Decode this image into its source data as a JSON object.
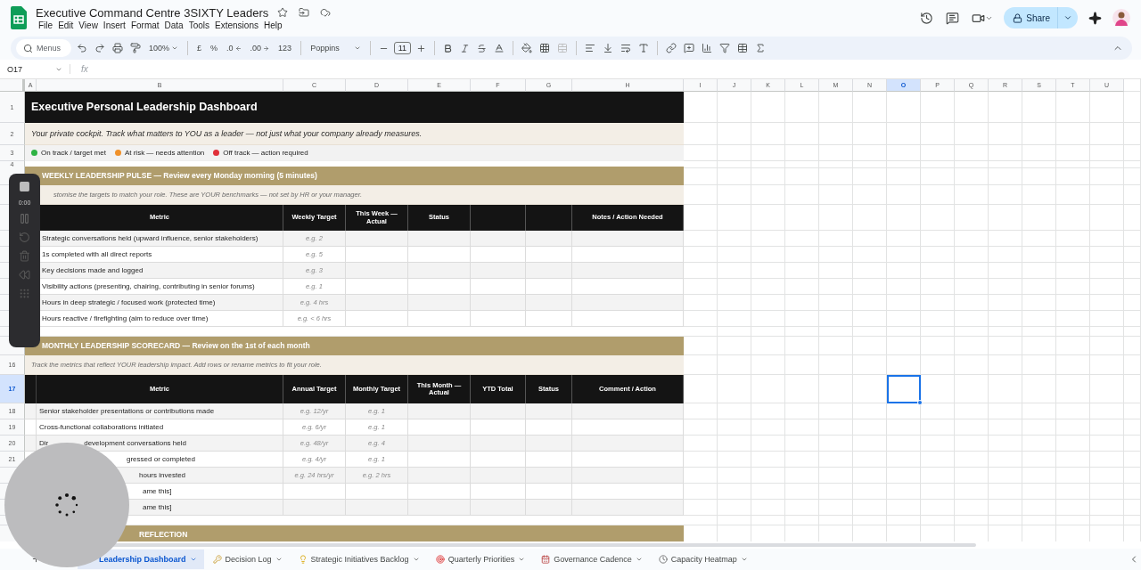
{
  "window": {
    "title": "Executive Command Centre 3SIXTY Leaders"
  },
  "menu": [
    "File",
    "Edit",
    "View",
    "Insert",
    "Format",
    "Data",
    "Tools",
    "Extensions",
    "Help"
  ],
  "share": {
    "label": "Share"
  },
  "toolbar": {
    "search_placeholder": "Menus",
    "zoom": "100%",
    "currency": "£",
    "percent": "%",
    "decrease_decimals": ".0",
    "increase_decimals": ".00",
    "number_format": "123",
    "font": "Poppins",
    "font_size": "11"
  },
  "formula_bar": {
    "cell_ref": "O17",
    "fx": "fx"
  },
  "columns": [
    {
      "label": "A",
      "selected": false
    },
    {
      "label": "B",
      "selected": false
    },
    {
      "label": "C",
      "selected": false
    },
    {
      "label": "D",
      "selected": false
    },
    {
      "label": "E",
      "selected": false
    },
    {
      "label": "F",
      "selected": false
    },
    {
      "label": "G",
      "selected": false
    },
    {
      "label": "H",
      "selected": false
    },
    {
      "label": "I",
      "selected": false
    },
    {
      "label": "J",
      "selected": false
    },
    {
      "label": "K",
      "selected": false
    },
    {
      "label": "L",
      "selected": false
    },
    {
      "label": "M",
      "selected": false
    },
    {
      "label": "N",
      "selected": false
    },
    {
      "label": "O",
      "selected": true
    },
    {
      "label": "P",
      "selected": false
    },
    {
      "label": "Q",
      "selected": false
    },
    {
      "label": "R",
      "selected": false
    },
    {
      "label": "S",
      "selected": false
    },
    {
      "label": "T",
      "selected": false
    },
    {
      "label": "U",
      "selected": false
    }
  ],
  "rows": [
    {
      "kind": "title",
      "number": "1",
      "selected": false,
      "text": "Executive Personal Leadership Dashboard"
    },
    {
      "kind": "subtitle",
      "number": "2",
      "selected": false,
      "text": "Your private cockpit. Track what matters to YOU as a leader — not just what your company already measures."
    },
    {
      "kind": "legend",
      "number": "3",
      "selected": false,
      "items": [
        {
          "label": "On track / target met",
          "color": "#2fb344"
        },
        {
          "label": "At risk — needs attention",
          "color": "#f0912a"
        },
        {
          "label": "Off track — action required",
          "color": "#e0303a"
        }
      ]
    },
    {
      "kind": "spacer",
      "number": "4",
      "selected": false
    },
    {
      "kind": "section",
      "selected": false,
      "text": "WEEKLY LEADERSHIP PULSE — Review every Monday morning (5 minutes)"
    },
    {
      "kind": "note",
      "selected": false,
      "text": "stomise the targets to match your role. These are YOUR benchmarks — not set by HR or your manager."
    },
    {
      "kind": "header",
      "selected": false,
      "cells": [
        "Metric",
        "Weekly Target",
        "This Week — Actual",
        "Status",
        null,
        null,
        "Notes / Action Needed"
      ]
    },
    {
      "kind": "data",
      "selected": false,
      "cells": [
        "Strategic conversations held (upward influence, senior stakeholders)",
        "e.g. 2"
      ]
    },
    {
      "kind": "data",
      "selected": false,
      "cells": [
        "1s completed with all direct reports",
        "e.g. 5"
      ]
    },
    {
      "kind": "data",
      "selected": false,
      "cells": [
        "Key decisions made and logged",
        "e.g. 3"
      ]
    },
    {
      "kind": "data",
      "selected": false,
      "cells": [
        "Visibility actions (presenting, chairing, contributing in senior forums)",
        "e.g. 1"
      ]
    },
    {
      "kind": "data",
      "selected": false,
      "cells": [
        "Hours in deep strategic / focused work (protected time)",
        "e.g. 4 hrs"
      ]
    },
    {
      "kind": "data",
      "selected": false,
      "cells": [
        "Hours reactive / firefighting (aim to reduce over time)",
        "e.g. < 6 hrs"
      ]
    },
    {
      "kind": "spacer",
      "selected": false
    },
    {
      "kind": "section",
      "selected": false,
      "text": "MONTHLY LEADERSHIP SCORECARD — Review on the 1st of each month"
    },
    {
      "kind": "note",
      "number": "16",
      "selected": false,
      "text": "Track the metrics that reflect YOUR leadership impact. Add rows or rename metrics to fit your role."
    },
    {
      "kind": "header",
      "number": "17",
      "selected": true,
      "cells": [
        "Metric",
        "Annual Target",
        "Monthly Target",
        "This Month — Actual",
        "YTD Total",
        "Status",
        "Comment / Action"
      ]
    },
    {
      "kind": "data",
      "number": "18",
      "selected": false,
      "cells": [
        "Senior stakeholder presentations or contributions made",
        "e.g. 12/yr",
        "e.g. 1"
      ]
    },
    {
      "kind": "data",
      "number": "19",
      "selected": false,
      "cells": [
        "Cross-functional collaborations initiated",
        "e.g. 6/yr",
        "e.g. 1"
      ]
    },
    {
      "kind": "data",
      "number": "20",
      "selected": false,
      "lead": "Dir",
      "cells": [
        "development conversations held",
        "e.g. 48/yr",
        "e.g. 4"
      ]
    },
    {
      "kind": "data",
      "number": "21",
      "selected": false,
      "cells": [
        "gressed or completed",
        "e.g. 4/yr",
        "e.g. 1"
      ]
    },
    {
      "kind": "data",
      "selected": false,
      "cells": [
        "hours invested",
        "e.g. 24 hrs/yr",
        "e.g. 2 hrs"
      ]
    },
    {
      "kind": "data",
      "selected": false,
      "cells": [
        "ame this]"
      ]
    },
    {
      "kind": "data",
      "selected": false,
      "cells": [
        "ame this]"
      ]
    },
    {
      "kind": "spacer",
      "selected": false
    },
    {
      "kind": "section",
      "selected": false,
      "text": "REFLECTION"
    }
  ],
  "recorder": {
    "time": "0:00"
  },
  "sheet_tabs": [
    {
      "label": "Leadership Dashboard",
      "selected": true
    },
    {
      "label": "Decision Log",
      "selected": false
    },
    {
      "label": "Strategic Initiatives Backlog",
      "selected": false
    },
    {
      "label": "Quarterly Priorities",
      "selected": false
    },
    {
      "label": "Governance Cadence",
      "selected": false
    },
    {
      "label": "Capacity Heatmap",
      "selected": false
    }
  ]
}
